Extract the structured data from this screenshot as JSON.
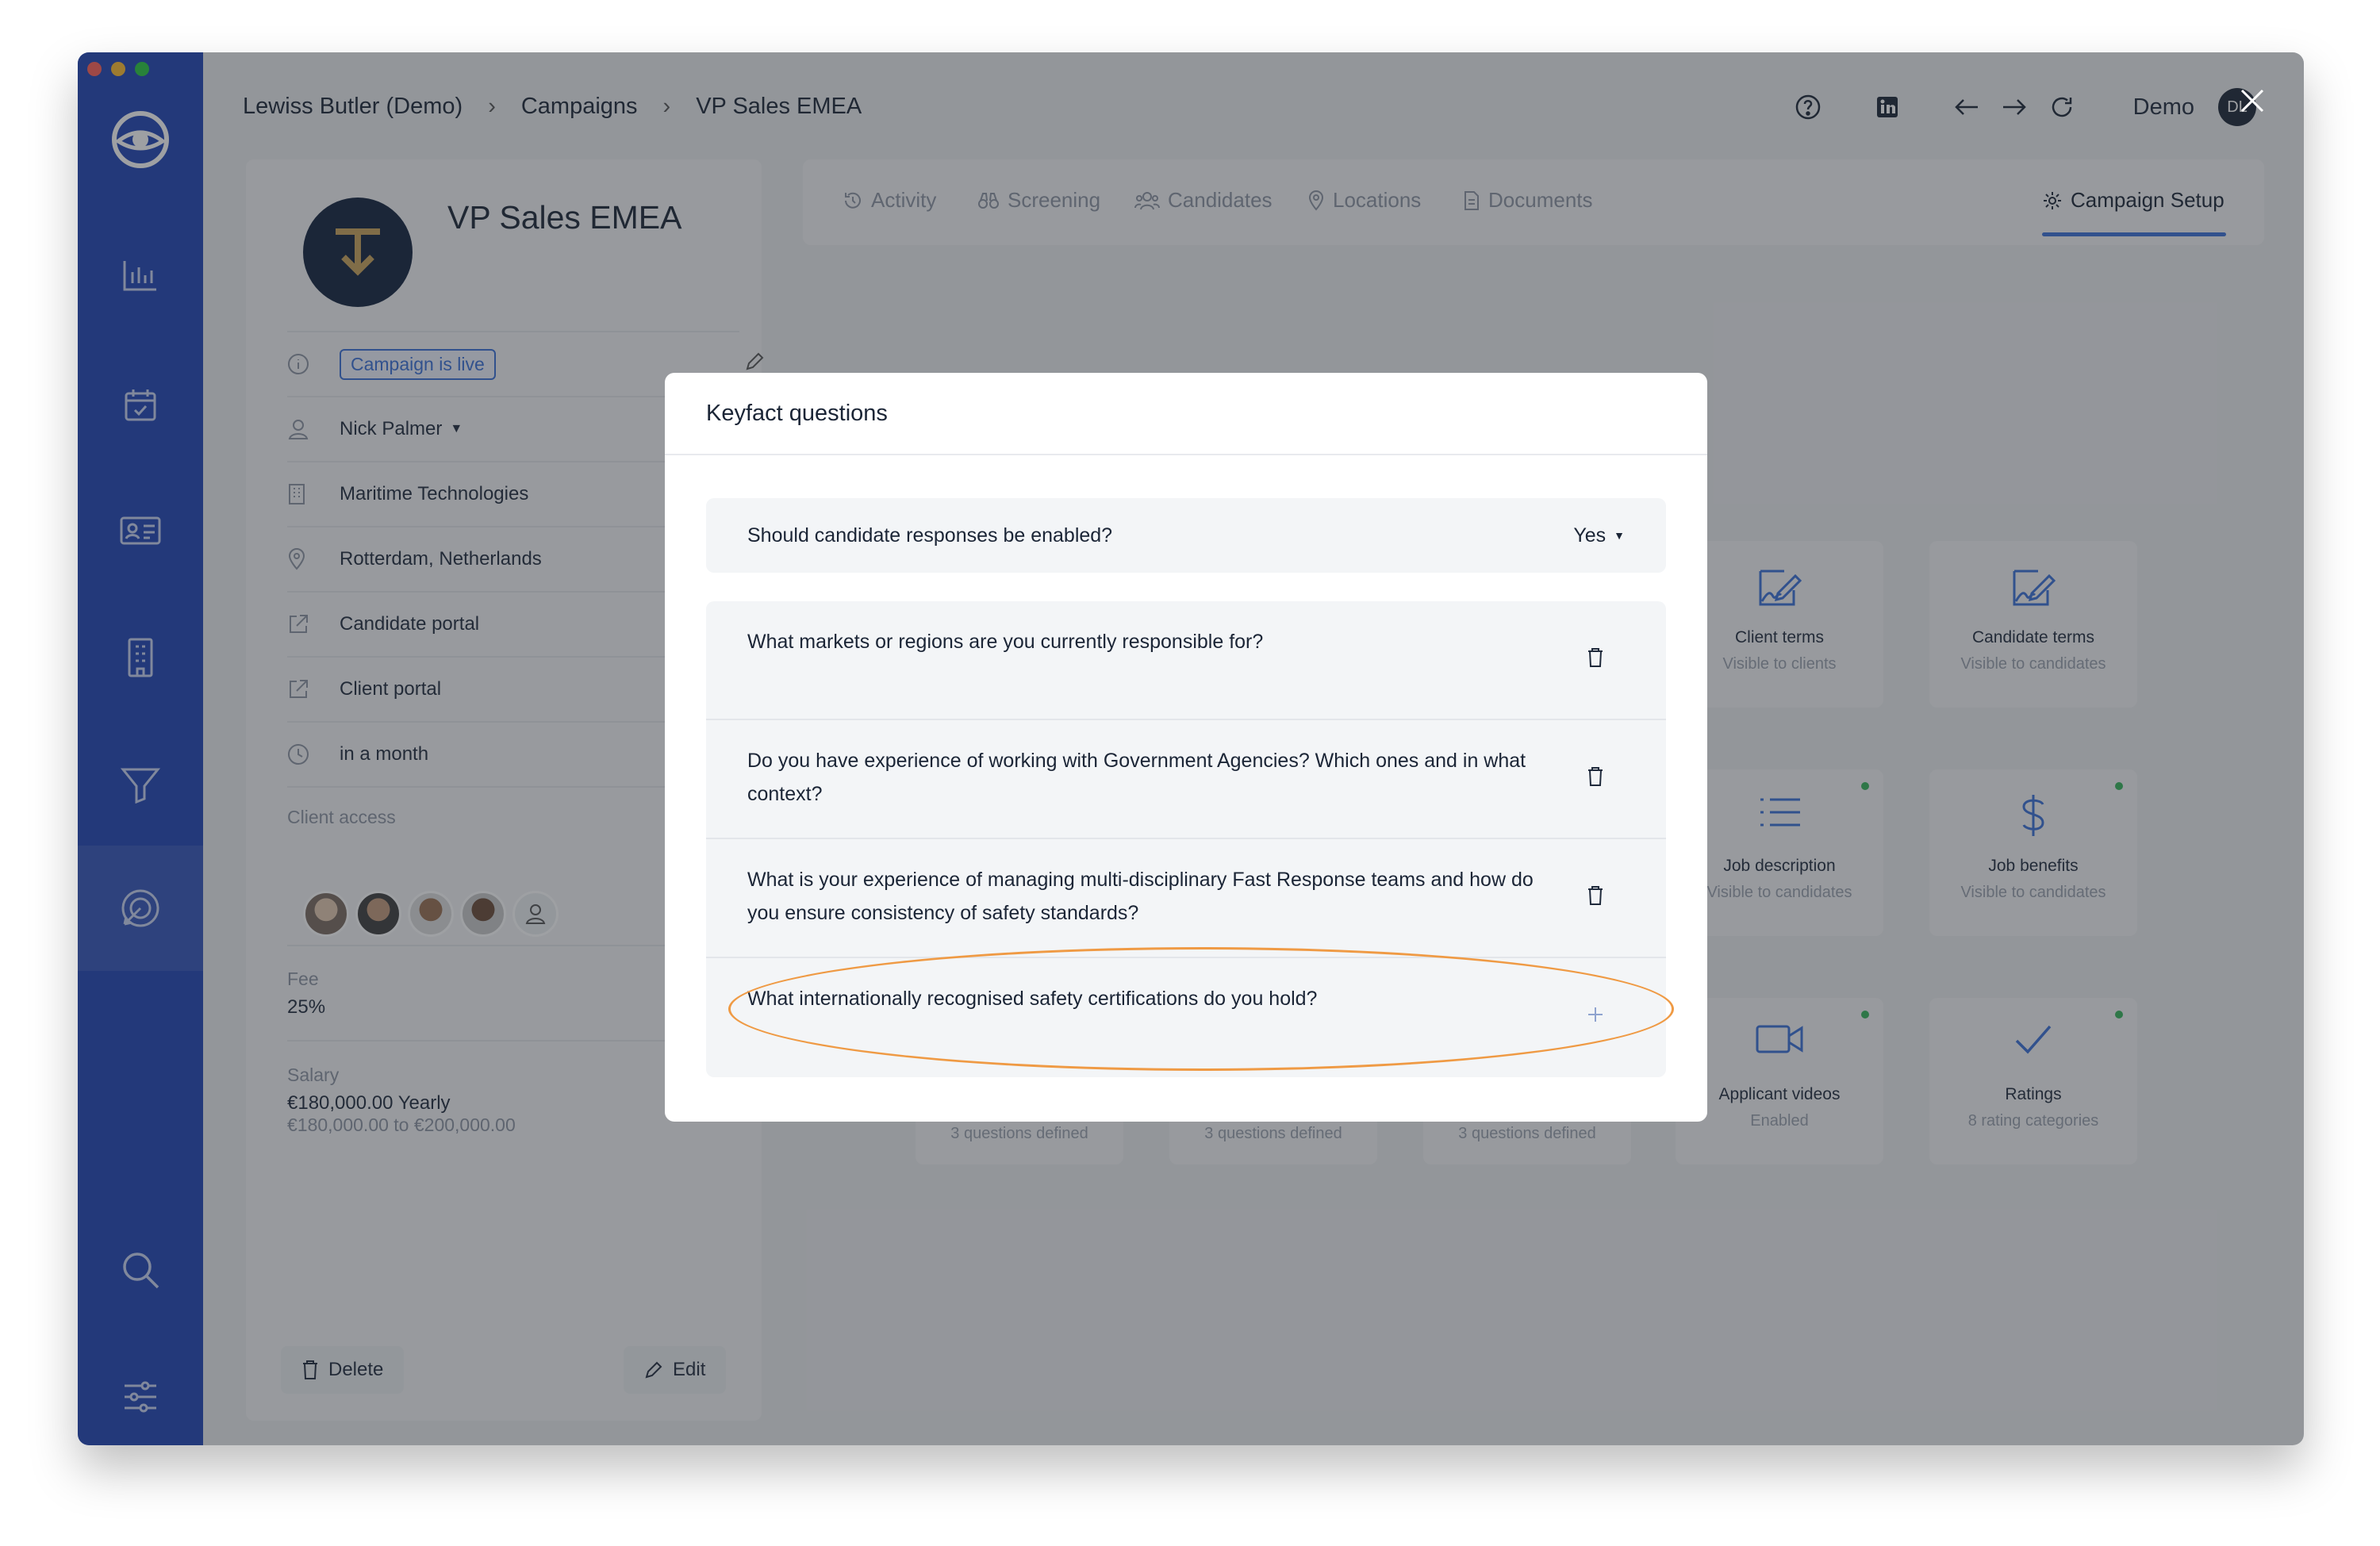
{
  "breadcrumb": [
    "Lewiss Butler (Demo)",
    "Campaigns",
    "VP Sales EMEA"
  ],
  "top_bar": {
    "user_label": "Demo",
    "avatar_initials": "DL"
  },
  "campaign": {
    "title": "VP Sales EMEA",
    "status": "Campaign is live",
    "owner": "Nick Palmer",
    "company": "Maritime Technologies",
    "location": "Rotterdam, Netherlands",
    "candidate_portal": "Candidate portal",
    "client_portal": "Client portal",
    "deadline": "in a month",
    "client_access_label": "Client access",
    "fee_label": "Fee",
    "fee_value": "25%",
    "salary_label": "Salary",
    "salary_value": "€180,000.00 Yearly",
    "salary_range": "€180,000.00 to €200,000.00",
    "delete_label": "Delete",
    "edit_label": "Edit"
  },
  "tabs": [
    {
      "label": "Activity",
      "icon": "history-icon"
    },
    {
      "label": "Screening",
      "icon": "binoculars-icon"
    },
    {
      "label": "Candidates",
      "icon": "users-icon"
    },
    {
      "label": "Locations",
      "icon": "map-pin-icon"
    },
    {
      "label": "Documents",
      "icon": "document-icon"
    },
    {
      "label": "Campaign Setup",
      "icon": "gear-icon",
      "active": true
    }
  ],
  "tiles": [
    {
      "title": "Client terms",
      "subtitle": "Visible to clients"
    },
    {
      "title": "Candidate terms",
      "subtitle": "Visible to candidates"
    },
    {
      "title": "Job description",
      "subtitle": "Visible to candidates"
    },
    {
      "title": "Job benefits",
      "subtitle": "Visible to candidates"
    },
    {
      "title": "Applicant videos",
      "subtitle": "Enabled"
    },
    {
      "title": "Ratings",
      "subtitle": "8 rating categories"
    }
  ],
  "tile_bottoms": [
    "3 questions defined",
    "3 questions defined",
    "3 questions defined"
  ],
  "modal": {
    "title": "Keyfact questions",
    "toggle_question": "Should candidate responses be enabled?",
    "toggle_value": "Yes",
    "questions": [
      "What markets or regions are you currently responsible for?",
      "Do you have experience of working with Government Agencies? Which ones and in what context?",
      "What is your experience of managing multi-disciplinary Fast Response teams and how do you ensure consistency of safety standards?",
      "What internationally recognised safety certifications do you hold?"
    ]
  },
  "colors": {
    "sidebar": "#1f44b4",
    "accent": "#3a6fd8",
    "highlight": "#ef9a44",
    "status_dot": "#35b45a"
  }
}
